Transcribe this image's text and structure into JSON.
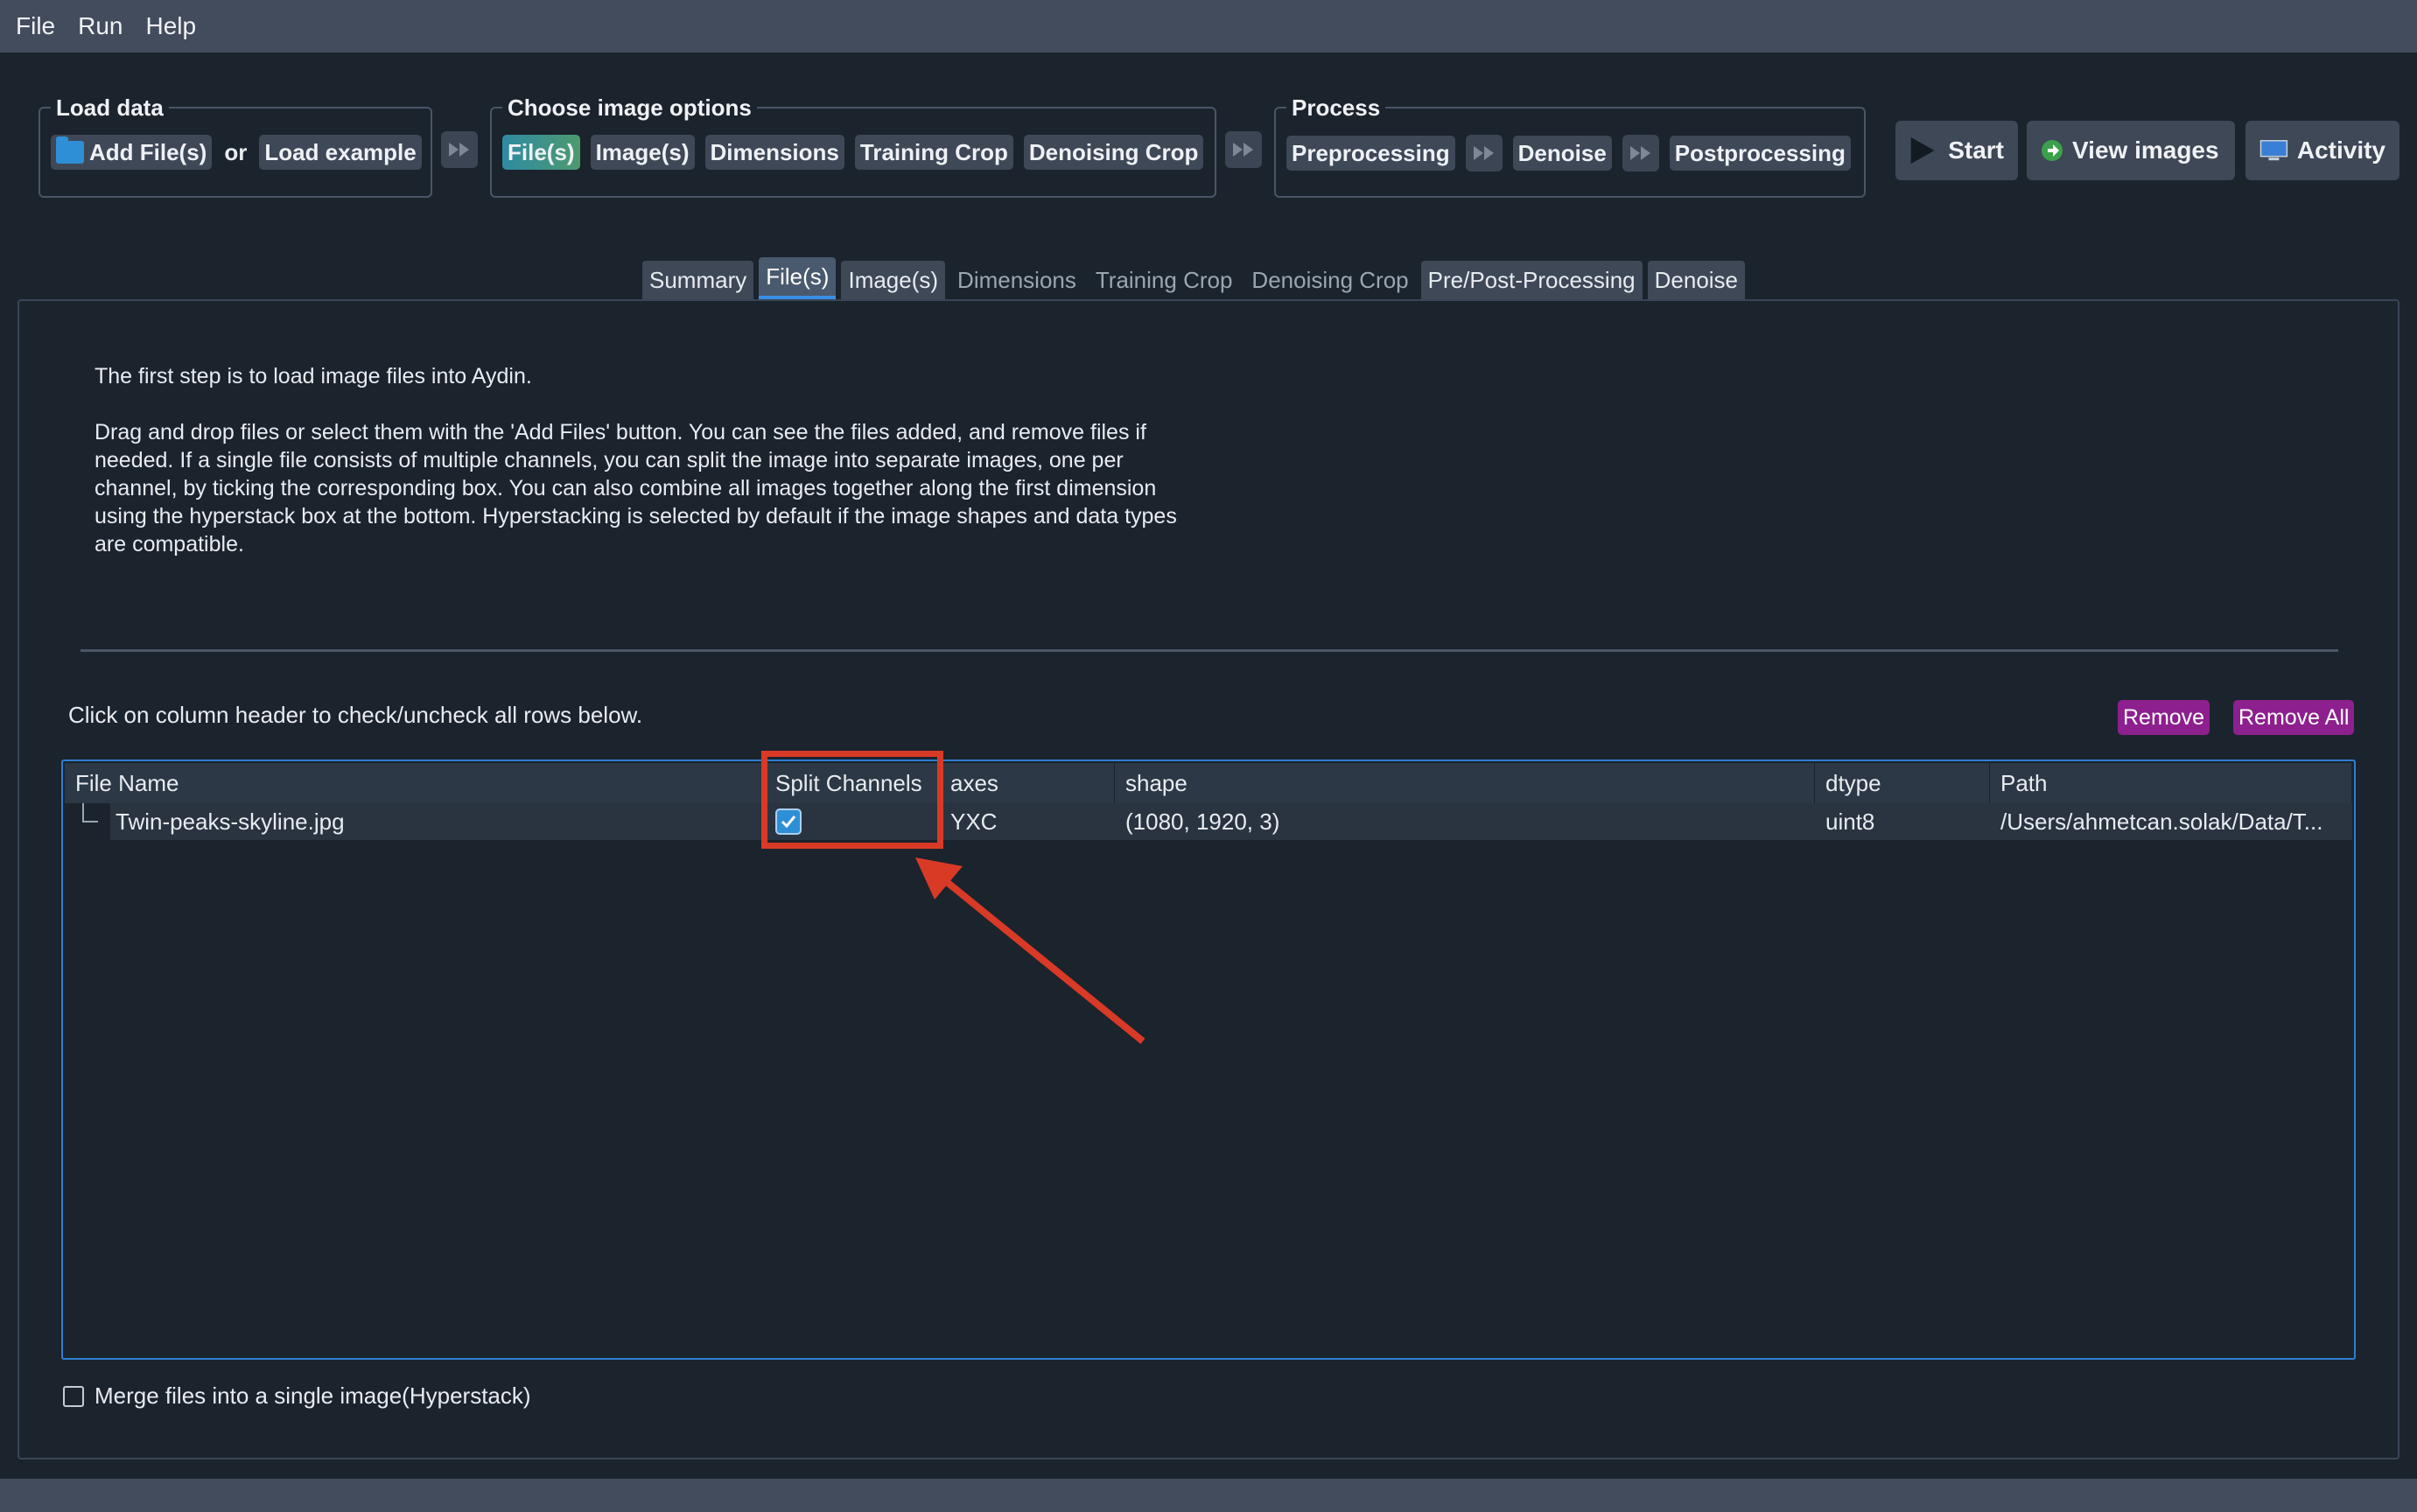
{
  "menu": [
    "File",
    "Run",
    "Help"
  ],
  "toolbar": {
    "load_data": {
      "title": "Load data",
      "add_files": "Add File(s)",
      "or": "or",
      "load_example": "Load example"
    },
    "image_options": {
      "title": "Choose image options",
      "items": [
        "File(s)",
        "Image(s)",
        "Dimensions",
        "Training Crop",
        "Denoising Crop"
      ]
    },
    "process": {
      "title": "Process",
      "preprocessing": "Preprocessing",
      "denoise": "Denoise",
      "postprocessing": "Postprocessing"
    },
    "start": "Start",
    "view_images": "View images",
    "activity": "Activity"
  },
  "tabs": [
    "Summary",
    "File(s)",
    "Image(s)",
    "Dimensions",
    "Training Crop",
    "Denoising Crop",
    "Pre/Post-Processing",
    "Denoise"
  ],
  "description": {
    "p1": "The first step is to load image files into Aydin.",
    "p2": "Drag and drop files or select them with the 'Add Files' button. You can see the files added, and remove files if needed. If a single file consists of multiple channels, you can split the image into separate images, one per channel, by ticking the corresponding box. You can also combine all images together along the first dimension using the hyperstack box at the bottom. Hyperstacking is selected by default if the image shapes and data types are compatible."
  },
  "hint": "Click on column header to check/uncheck all rows below.",
  "remove": "Remove",
  "remove_all": "Remove All",
  "table": {
    "headers": [
      "File Name",
      "Split Channels",
      "axes",
      "shape",
      "dtype",
      "Path"
    ],
    "row": {
      "file_name": "Twin-peaks-skyline.jpg",
      "split_channels": true,
      "axes": "YXC",
      "shape": "(1080, 1920, 3)",
      "dtype": "uint8",
      "path": "/Users/ahmetcan.solak/Data/T..."
    }
  },
  "merge_label": "Merge files into a single image(Hyperstack)",
  "colors": {
    "accent": "#2e8fd6",
    "highlight": "#d93a26",
    "remove_btn": "#8d1f8e"
  }
}
